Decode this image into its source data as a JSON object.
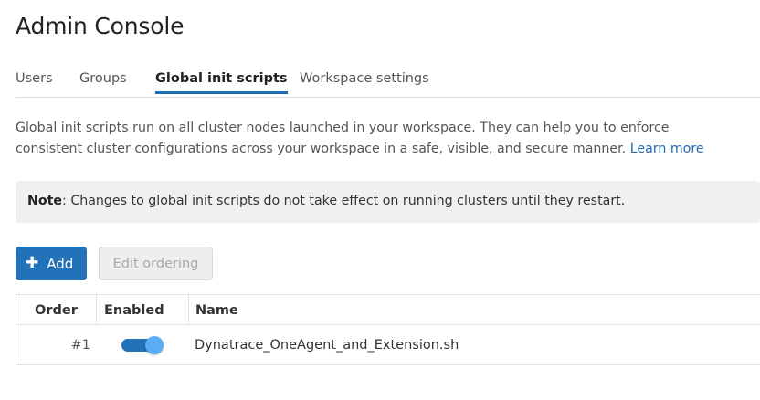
{
  "header": {
    "title": "Admin Console"
  },
  "tabs": [
    {
      "label": "Users",
      "active": false
    },
    {
      "label": "Groups",
      "active": false
    },
    {
      "label": "Global init scripts",
      "active": true
    },
    {
      "label": "Workspace settings",
      "active": false
    }
  ],
  "description": {
    "text": "Global init scripts run on all cluster nodes launched in your workspace. They can help you to enforce consistent cluster configurations across your workspace in a safe, visible, and secure manner.",
    "link": "Learn more"
  },
  "note": {
    "label": "Note",
    "text": ": Changes to global init scripts do not take effect on running clusters until they restart."
  },
  "toolbar": {
    "add_label": "Add",
    "edit_ordering_label": "Edit ordering"
  },
  "table": {
    "columns": [
      "Order",
      "Enabled",
      "Name"
    ],
    "rows": [
      {
        "order": "#1",
        "enabled": true,
        "name": "Dynatrace_OneAgent_and_Extension.sh"
      }
    ]
  },
  "colors": {
    "accent": "#2272b9",
    "toggle_knob": "#5aacf5",
    "note_bg": "#f0f0f0"
  }
}
